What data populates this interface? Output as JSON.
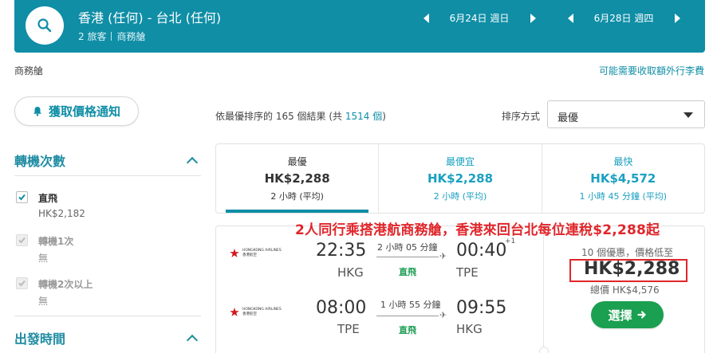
{
  "header": {
    "route": "香港 (任何) - 台北 (任何)",
    "passengers": "2 旅客",
    "cabin": "商務艙",
    "depart_date": "6月24日 週日",
    "return_date": "6月28日 週四"
  },
  "cabin_label": "商務艙",
  "baggage_link": "可能需要收取額外行李費",
  "price_alert_label": "獲取價格通知",
  "filters": {
    "stops_title": "轉機次數",
    "options": [
      {
        "label": "直飛",
        "price": "HK$2,182",
        "checked": true,
        "enabled": true
      },
      {
        "label": "轉機1次",
        "price": "無",
        "checked": true,
        "enabled": false
      },
      {
        "label": "轉機2次以上",
        "price": "無",
        "checked": true,
        "enabled": false
      }
    ],
    "depart_time_title": "出發時間"
  },
  "results": {
    "prefix": "依最優排序的 165 個結果 (共 ",
    "total": "1514 個",
    "suffix": ")",
    "sort_label": "排序方式",
    "sort_value": "最優"
  },
  "tabs": [
    {
      "title": "最優",
      "price": "HK$2,288",
      "duration": "2 小時 (平均)"
    },
    {
      "title": "最便宜",
      "price": "HK$2,288",
      "duration": "2 小時 (平均)"
    },
    {
      "title": "最快",
      "price": "HK$4,572",
      "duration": "1 小時 45 分鐘 (平均)"
    }
  ],
  "promo_text": "2人同行乘搭港航商務艙，香港來回台北每位連稅$2,288起",
  "itinerary": {
    "outbound": {
      "airline_en": "HONGKONG AIRLINES",
      "airline_zh": "香港航空",
      "depart_time": "22:35",
      "depart_airport": "HKG",
      "duration": "2 小時 05 分鐘",
      "stops": "直飛",
      "arrive_time": "00:40",
      "day_offset": "+1",
      "arrive_airport": "TPE"
    },
    "inbound": {
      "airline_en": "HONGKONG AIRLINES",
      "airline_zh": "香港航空",
      "depart_time": "08:00",
      "depart_airport": "TPE",
      "duration": "1 小時 55 分鐘",
      "stops": "直飛",
      "arrive_time": "09:55",
      "arrive_airport": "HKG"
    },
    "deals": "10 個優惠，價格低至",
    "price": "HK$2,288",
    "total": "總價 HK$4,576",
    "select_label": "選擇"
  },
  "colors": {
    "brand": "#0f8ea6",
    "select_green": "#1aa050",
    "promo_red": "#e0262b"
  }
}
